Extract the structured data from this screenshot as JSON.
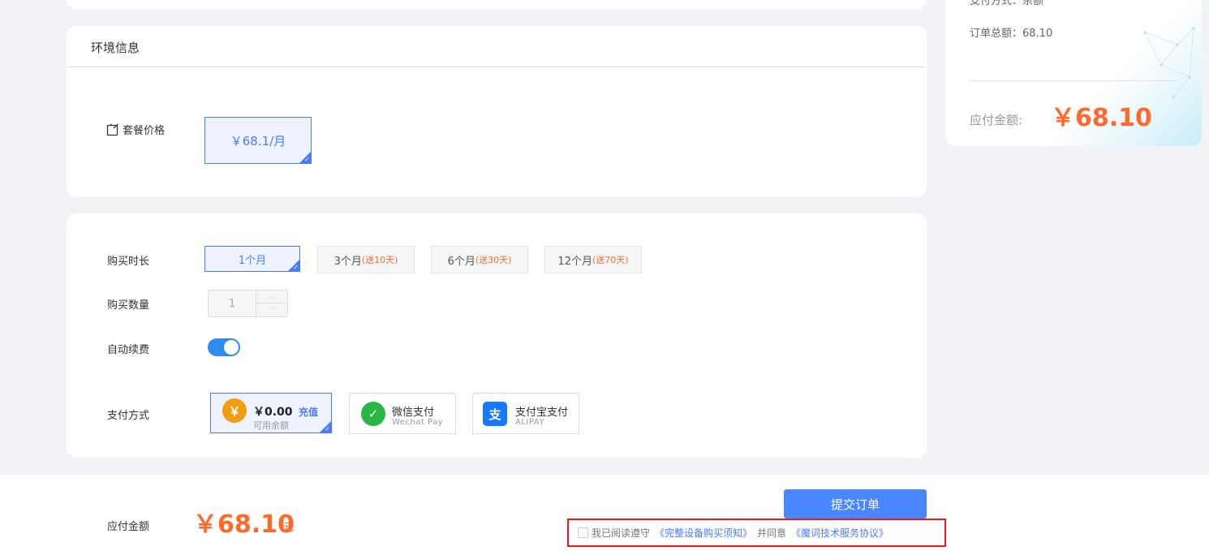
{
  "side_panel": {
    "cut_text": "支付方式：余额",
    "order_total": "订单总额：68.10",
    "payable_label": "应付金额:",
    "payable_amount": "￥68.10"
  },
  "env": {
    "title": "环境信息",
    "package_label": "套餐价格",
    "package_price": "￥68.1/月"
  },
  "purchase": {
    "duration_label": "购买时长",
    "durations": [
      {
        "label": "1个月",
        "gift": ""
      },
      {
        "label": "3个月",
        "gift": "(送10天)"
      },
      {
        "label": "6个月",
        "gift": "(送30天)"
      },
      {
        "label": "12个月",
        "gift": "(送70天)"
      }
    ],
    "selected_duration": "1个月",
    "quantity_label": "购买数量",
    "quantity": "1",
    "auto_renew_label": "自动续费",
    "auto_renew": true,
    "payment_label": "支付方式",
    "balance": {
      "amount": "￥0.00",
      "recharge": "充值",
      "sub": "可用余额"
    },
    "wechat": {
      "title": "微信支付",
      "sub": "Wechat Pay"
    },
    "alipay": {
      "title": "支付宝支付",
      "sub": "ALIPAY"
    }
  },
  "footer": {
    "payable_label": "应付金额",
    "payable_amount": "￥68.10",
    "unit": "元",
    "submit": "提交订单",
    "agree_prefix": "我已阅读遵守",
    "agree_link1": "《完整设备购买须知》",
    "agree_mid": "并同意",
    "agree_link2": "《魔词技术服务协议》"
  },
  "colors": {
    "accent": "#4a7bff",
    "price": "#ff6a2b",
    "toggle_on": "#2d8cf0",
    "highlight_border": "#e81c1c"
  }
}
